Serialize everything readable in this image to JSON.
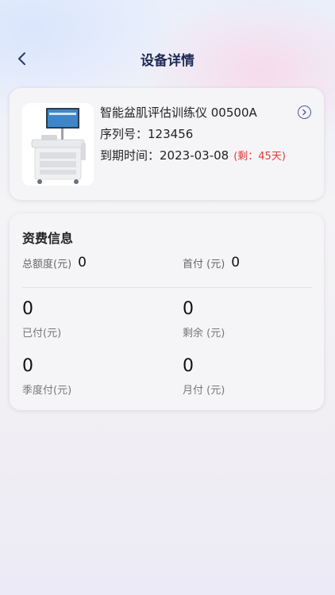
{
  "header": {
    "title": "设备详情",
    "back_icon": "chevron-left-icon"
  },
  "device": {
    "name": "智能盆肌评估训练仪 00500A",
    "serial_label": "序列号：",
    "serial": "123456",
    "expiry_label": "到期时间：",
    "expiry": "2023-03-08",
    "remaining": "(剩：45天)",
    "detail_icon": "chevron-right-circle-icon"
  },
  "fees": {
    "title": "资费信息",
    "total_label": "总额度(元)",
    "total_value": "0",
    "down_label": "首付 (元)",
    "down_value": "0",
    "paid_value": "0",
    "paid_label": "已付(元)",
    "rest_value": "0",
    "rest_label": "剩余 (元)",
    "quarter_value": "0",
    "quarter_label": "季度付(元)",
    "month_value": "0",
    "month_label": "月付 (元)"
  },
  "colors": {
    "title": "#1f2a55",
    "remaining": "#e03a3a",
    "card": "#f5f5f7"
  }
}
